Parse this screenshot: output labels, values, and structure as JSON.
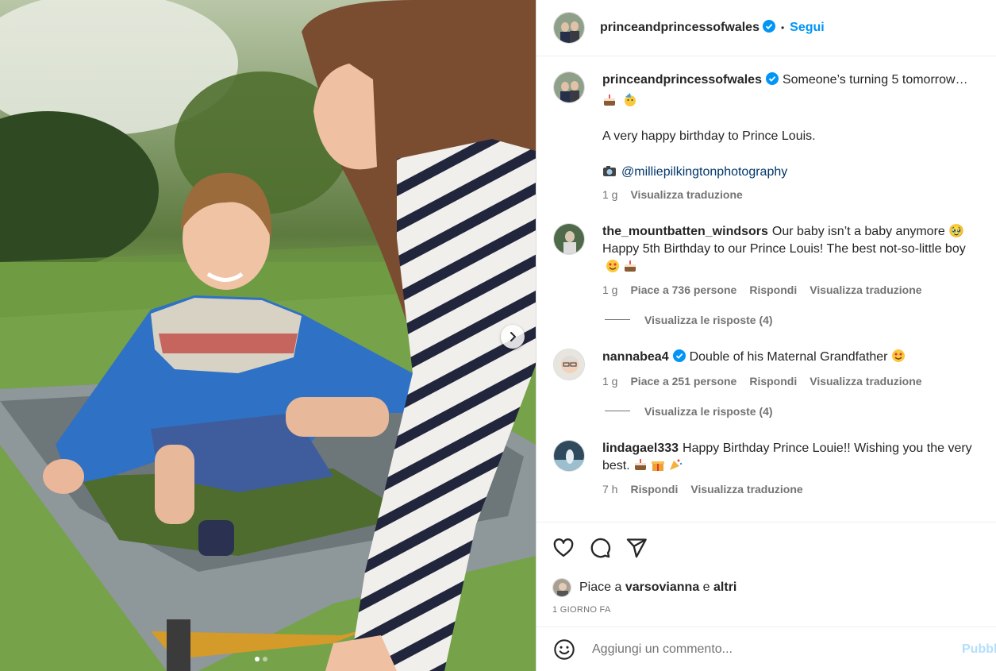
{
  "post": {
    "author": "princeandprincessofwales",
    "follow_label": "Segui",
    "follow_separator": "•",
    "carousel": {
      "slides": 2,
      "active": 1
    }
  },
  "caption": {
    "username": "princeandprincessofwales",
    "line1": "Someone’s turning 5 tomorrow…",
    "line2": "A very happy birthday to Prince Louis.",
    "credit": "@milliepilkingtonphotography",
    "time": "1 g",
    "translate": "Visualizza traduzione"
  },
  "comments": [
    {
      "username": "the_mountbatten_windsors",
      "text": "Our baby isn’t a baby anymore 🥹 Happy 5th Birthday to our Prince Louis! The best not-so-little boy",
      "time": "1 g",
      "likes": "Piace a 736 persone",
      "reply": "Rispondi",
      "translate": "Visualizza traduzione",
      "replies": "Visualizza le risposte (4)"
    },
    {
      "username": "nannabea4",
      "text": "Double of his Maternal Grandfather",
      "time": "1 g",
      "likes": "Piace a 251 persone",
      "reply": "Rispondi",
      "translate": "Visualizza traduzione",
      "replies": "Visualizza le risposte (4)"
    },
    {
      "username": "lindagael333",
      "text": "Happy Birthday Prince Louie!! Wishing you the very best.",
      "time": "7 h",
      "reply": "Rispondi",
      "translate": "Visualizza traduzione"
    }
  ],
  "likes_line": {
    "prefix": "Piace a",
    "user": "varsovianna",
    "conj": "e",
    "others": "altri"
  },
  "timestamp": "1 GIORNO FA",
  "add_comment": {
    "placeholder": "Aggiungi un commento...",
    "publish": "Pubblica"
  },
  "icons": [
    "heart-icon",
    "comment-icon",
    "share-icon",
    "emoji-icon",
    "verified-icon",
    "chevron-right-icon"
  ],
  "colors": {
    "accent": "#0095f6",
    "verified": "#0095f6",
    "publish_disabled": "#b2dffc"
  }
}
